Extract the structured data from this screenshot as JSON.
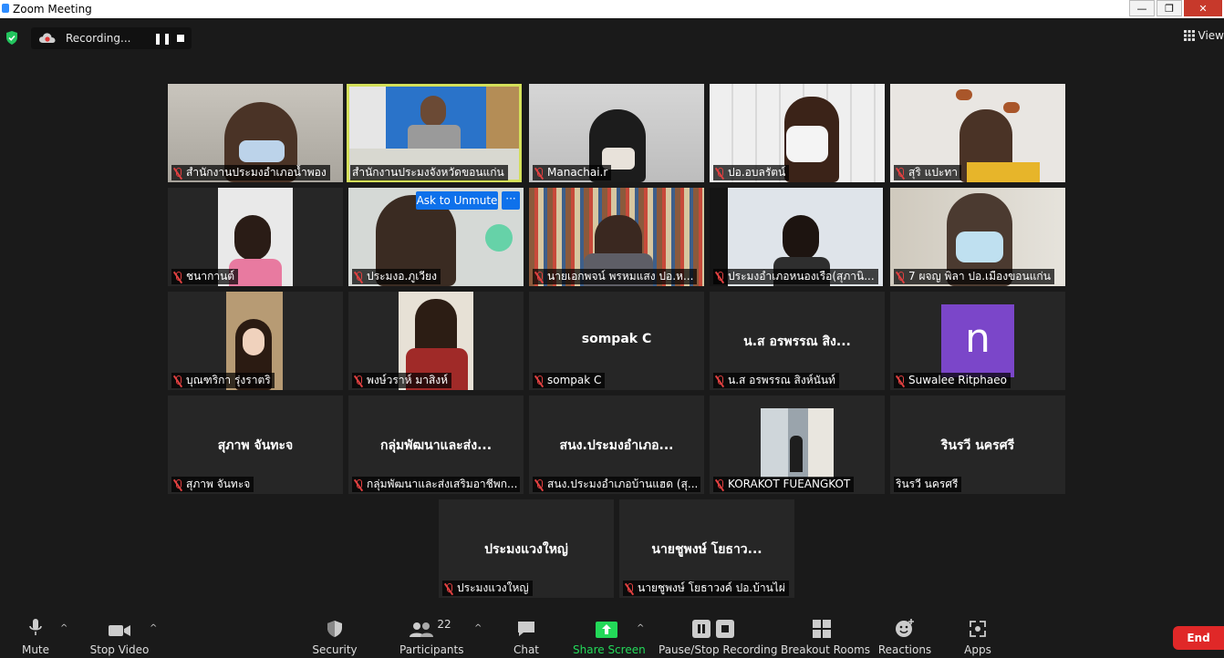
{
  "window": {
    "title": "Zoom Meeting",
    "min": "—",
    "max": "❐",
    "close": "✕"
  },
  "recording": {
    "label": "Recording...",
    "pause": "❚❚"
  },
  "view_label": "View",
  "tiles": [
    {
      "name": "สำนักงานประมงอำเภอน้ำพอง"
    },
    {
      "name": "สำนักงานประมงจังหวัดขอนแก่น"
    },
    {
      "name": "Manachai.r"
    },
    {
      "name": "ปอ.อบลรัตน์"
    },
    {
      "name": "สุริ  แปะทา"
    },
    {
      "name": "ชนากานต์"
    },
    {
      "name": "ประมงอ.ภูเวียง",
      "ask_unmute": "Ask to Unmute",
      "more": "···"
    },
    {
      "name": "นายเอกพจน์ พรหมแสง ปอ.ห..."
    },
    {
      "name": "ประมงอำเภอหนองเรือ(สุภานิ..."
    },
    {
      "name": "7 ผจญ พิลา ปอ.เมืองขอนแก่น"
    },
    {
      "name": "บุณฑริกา  รุ่งราตริ"
    },
    {
      "name": "พงษ์วราห์  มาสิงห์"
    },
    {
      "name": "sompak C",
      "big": "sompak C"
    },
    {
      "name": "น.ส อรพรรณ สิงห์นันท์",
      "big": "น.ส อรพรรณ สิง..."
    },
    {
      "name": "Suwalee Ritphaeo",
      "avatar": "n"
    },
    {
      "name": "สุภาพ  จันทะจ",
      "big": "สุภาพ  จันทะจ"
    },
    {
      "name": "กลุ่มพัฒนาและส่งเสริมอาชีพก...",
      "big": "กลุ่มพัฒนาและส่ง..."
    },
    {
      "name": "สนง.ประมงอำเภอบ้านแฮด (สุ...",
      "big": "สนง.ประมงอำเภอ..."
    },
    {
      "name": "KORAKOT FUEANGKOT"
    },
    {
      "name": "รินรวี นครศรี",
      "big": "รินรวี นครศรี"
    },
    {
      "name": "ประมงแวงใหญ่",
      "big": "ประมงแวงใหญ่"
    },
    {
      "name": "นายชูพงษ์ โยธาวงค์ ปอ.บ้านไผ่",
      "big": "นายชูพงษ์ โยธาว..."
    }
  ],
  "toolbar": {
    "mute": "Mute",
    "stop_video": "Stop Video",
    "security": "Security",
    "participants": "Participants",
    "participants_count": "22",
    "chat": "Chat",
    "share_screen": "Share Screen",
    "pause_stop_recording": "Pause/Stop Recording",
    "breakout_rooms": "Breakout Rooms",
    "reactions": "Reactions",
    "apps": "Apps",
    "end": "End"
  },
  "colors": {
    "active_speaker": "#d4e05a",
    "share_green": "#23d959",
    "end_red": "#e02828",
    "unmute_blue": "#0e71eb"
  }
}
